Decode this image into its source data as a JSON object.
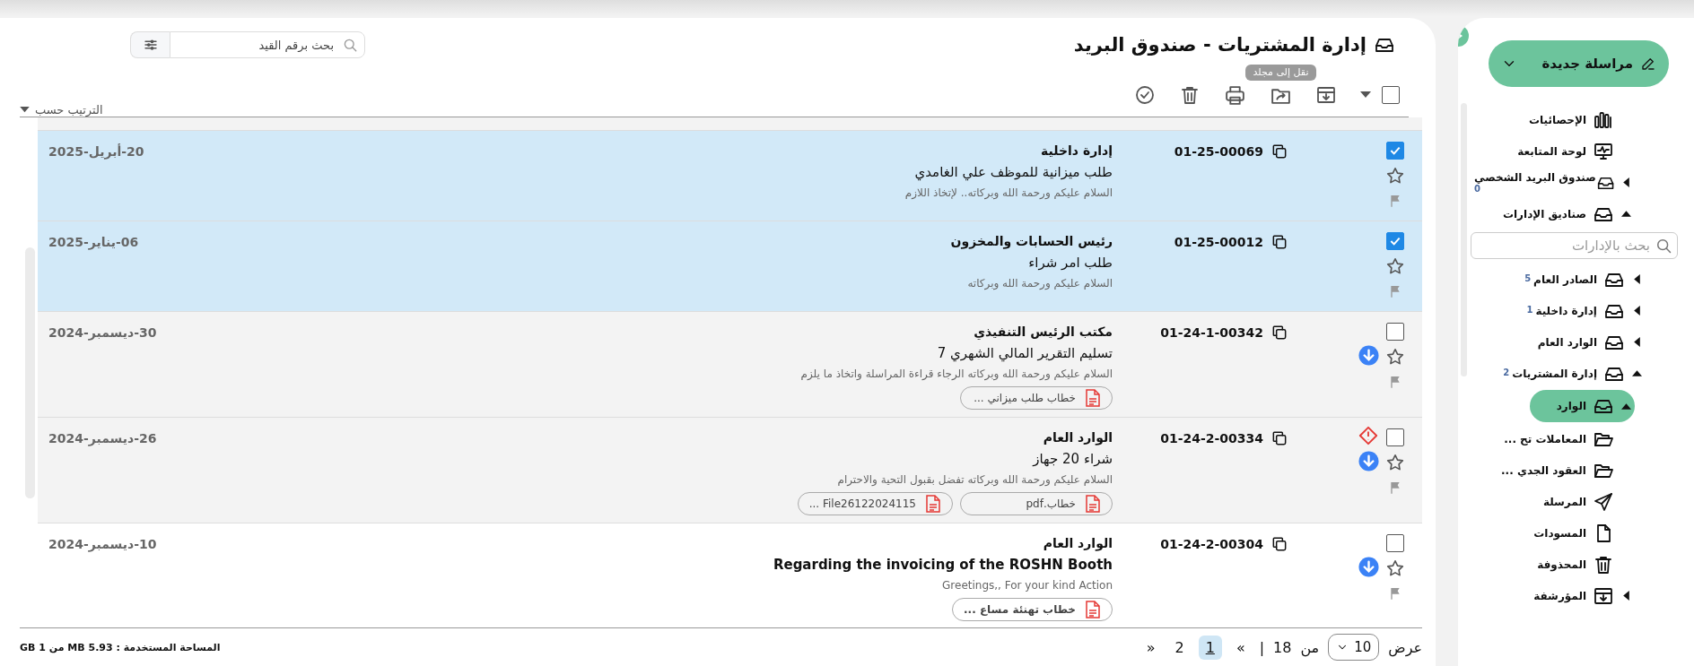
{
  "sidebar": {
    "new_message": {
      "label": "مراسلة جديدة"
    },
    "items": [
      {
        "kind": "stats",
        "label": "الإحصائيات",
        "selected": false
      },
      {
        "kind": "dashboard",
        "label": "لوحة المتابعة",
        "selected": false
      },
      {
        "kind": "mailbox",
        "label": "صندوق البريد الشخصي",
        "count": "0",
        "expanded": false,
        "selected": false
      },
      {
        "kind": "mailbox",
        "label": "صناديق الإدارات",
        "expanded": true,
        "selected": false,
        "search_placeholder": "بحث بالإدارات",
        "children": [
          {
            "kind": "mailbox",
            "label": "الصادر العام",
            "count": "5",
            "expanded": false,
            "selected": false
          },
          {
            "kind": "mailbox",
            "label": "إدارة داخلية",
            "count": "1",
            "expanded": false,
            "selected": false
          },
          {
            "kind": "mailbox",
            "label": "الوارد العام",
            "expanded": false,
            "selected": false
          },
          {
            "kind": "mailbox",
            "label": "إدارة المشتريات",
            "count": "2",
            "expanded": true,
            "selected": false,
            "children": [
              {
                "kind": "mailbox",
                "label": "الوارد",
                "expanded": true,
                "selected": true,
                "children": [
                  {
                    "kind": "folder",
                    "label": "المعاملات تح ...",
                    "selected": false
                  },
                  {
                    "kind": "folder",
                    "label": "العقود الجدي ...",
                    "selected": false
                  }
                ]
              }
            ]
          }
        ]
      },
      {
        "kind": "sent",
        "label": "المرسلة",
        "selected": false
      },
      {
        "kind": "drafts",
        "label": "المسودات",
        "selected": false
      },
      {
        "kind": "deleted",
        "label": "المحذوفة",
        "selected": false
      },
      {
        "kind": "archived",
        "label": "المؤرشفة",
        "expanded": false,
        "selected": false
      }
    ]
  },
  "header": {
    "title": "إدارة المشتريات - صندوق البريد",
    "search": {
      "placeholder": "بحث برقم القيد"
    }
  },
  "toolbar": {
    "select_all_checked": false,
    "tooltip": "نقل إلى مجلد",
    "sort_label": "الترتيب حسب"
  },
  "messages": [
    {
      "checked": true,
      "unread": false,
      "starred": false,
      "flagged": false,
      "important": false,
      "download": false,
      "ref": "01-25-00069",
      "sender": "إدارة داخلية",
      "subject": "طلب ميزانية للموظف علي الغامدي",
      "preview": "السلام عليكم ورحمة الله وبركاته.. لإتخاذ اللازم",
      "date": "20-أبريل-2025"
    },
    {
      "checked": true,
      "unread": false,
      "starred": false,
      "flagged": false,
      "important": false,
      "download": false,
      "ref": "01-25-00012",
      "sender": "رئيس الحسابات والمخزون",
      "subject": "طلب امر شراء",
      "preview": "السلام عليكم ورحمة الله وبركاته",
      "date": "06-يناير-2025"
    },
    {
      "checked": false,
      "unread": false,
      "starred": false,
      "flagged": false,
      "important": false,
      "download": true,
      "ref": "01-24-1-00342",
      "sender": "مكتب الرئيس التنفيذي",
      "subject": "تسليم التقرير المالي الشهري 7",
      "preview": "السلام عليكم ورحمة الله وبركاته الرجاء قراءة المراسلة واتخاذ ما يلزم",
      "date": "30-ديسمبر-2024",
      "attachments": [
        "خطاب طلب ميزاني ..."
      ]
    },
    {
      "checked": false,
      "unread": false,
      "starred": false,
      "flagged": false,
      "important": true,
      "download": true,
      "ref": "01-24-2-00334",
      "sender": "الوارد العام",
      "subject": "شراء 20 جهاز",
      "preview": "السلام عليكم ورحمة الله وبركاته تفضل بقبول التحية والاحترام",
      "date": "26-ديسمبر-2024",
      "attachments": [
        "خطاب.pdf",
        "File26122024115 ..."
      ]
    },
    {
      "checked": false,
      "unread": true,
      "starred": false,
      "flagged": false,
      "important": false,
      "download": true,
      "ref": "01-24-2-00304",
      "sender": "الوارد العام",
      "subject": "Regarding the invoicing of the ROSHN Booth",
      "preview": "Greetings,, For your kind Action",
      "date": "10-ديسمبر-2024",
      "attachments": [
        "خطاب تهنئة مساع ..."
      ]
    }
  ],
  "footer": {
    "show_label": "عرض",
    "page_size": "10",
    "of_label": "من",
    "total": "18",
    "separator": "|",
    "first": "«",
    "pages": [
      {
        "label": "1",
        "selected": true
      },
      {
        "label": "2",
        "selected": false
      }
    ],
    "last": "»",
    "storage": "المساحة المستخدمة : 5.93 MB من 1 GB"
  }
}
